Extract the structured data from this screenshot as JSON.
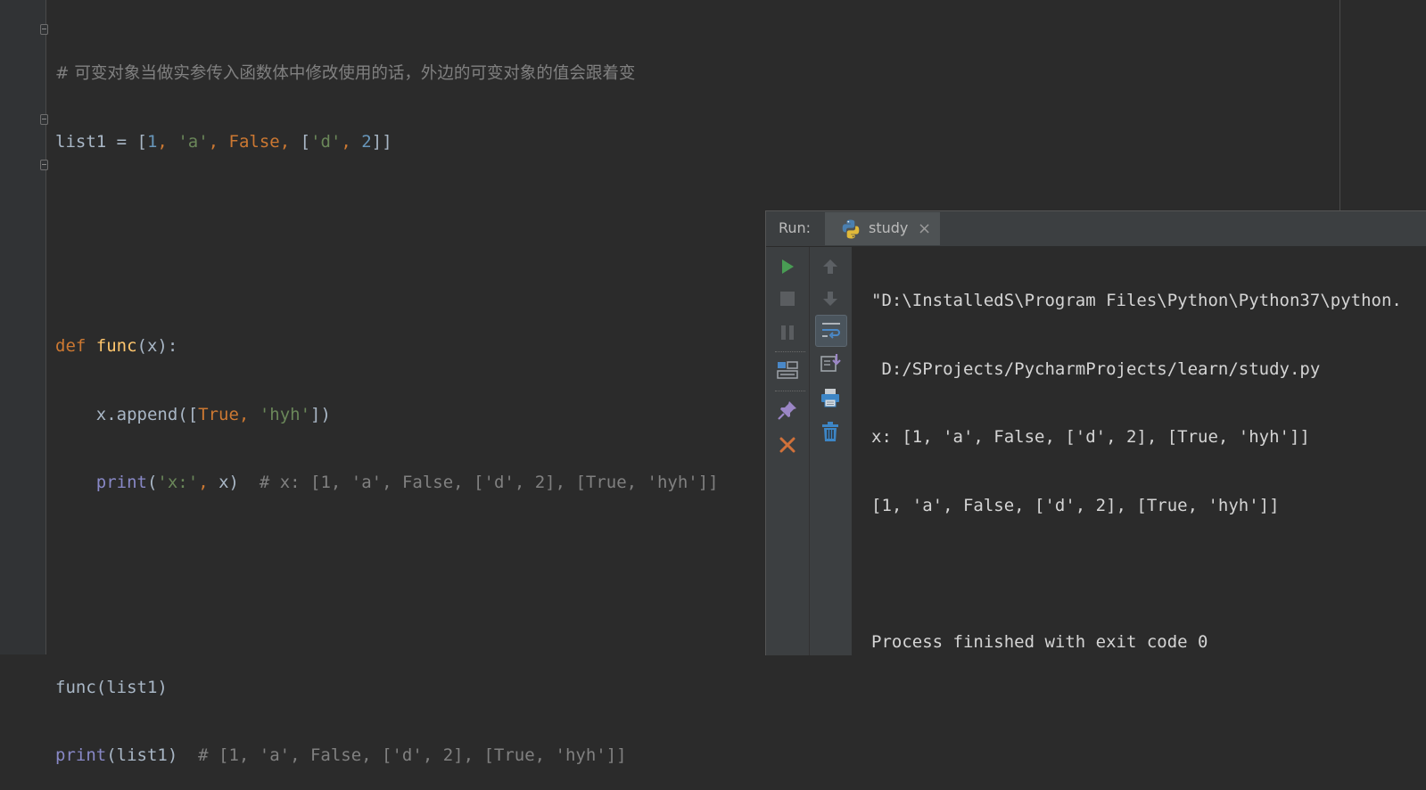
{
  "editor": {
    "line1": {
      "comment": "# 可变对象当做实参传入函数体中修改使用的话，外边的可变对象的值会跟着变"
    },
    "line2": {
      "t1": "list1 = ",
      "t2": "[",
      "t3": "1",
      "t4": ", ",
      "t5": "'a'",
      "t6": ", ",
      "t7": "False",
      "t8": ", ",
      "t9": "[",
      "t10": "'d'",
      "t11": ", ",
      "t12": "2",
      "t13": "]]"
    },
    "line5": {
      "t1": "def ",
      "t2": "func",
      "t3": "(x):"
    },
    "line6": {
      "t1": "    x.append([",
      "t2": "True",
      "t3": ", ",
      "t4": "'hyh'",
      "t5": "])"
    },
    "line7": {
      "t1": "    ",
      "t2": "print",
      "t3": "(",
      "t4": "'x:'",
      "t5": ", ",
      "t6": "x)  ",
      "t7": "# x: [1, 'a', False, ['d', 2], [True, 'hyh']]"
    },
    "line10": {
      "t1": "func(list1)"
    },
    "line11": {
      "t1": "print",
      "t2": "(list1)  ",
      "t3": "# [1, 'a', False, ['d', 2], [True, 'hyh']]"
    }
  },
  "run_panel": {
    "label": "Run:",
    "tab": {
      "label": "study",
      "close": "×",
      "icon": "python-icon"
    },
    "toolbar_left": [
      "run-icon",
      "stop-icon",
      "pause-icon",
      "layout-icon",
      "pin-icon",
      "close-icon"
    ],
    "toolbar_right": [
      "up-arrow-icon",
      "down-arrow-icon",
      "soft-wrap-icon",
      "scroll-to-end-icon",
      "print-icon",
      "trash-icon"
    ],
    "console_lines": [
      "\"D:\\InstalledS\\Program Files\\Python\\Python37\\python.",
      " D:/SProjects/PycharmProjects/learn/study.py",
      "x: [1, 'a', False, ['d', 2], [True, 'hyh']]",
      "[1, 'a', False, ['d', 2], [True, 'hyh']]",
      "",
      "Process finished with exit code 0"
    ]
  },
  "colors": {
    "editor_bg": "#2b2b2b",
    "comment": "#808080",
    "number": "#6897bb",
    "string": "#6a8759",
    "keyword": "#cc7832",
    "function": "#ffc66d",
    "builtin": "#8888c6",
    "run_green": "#499c54",
    "close_orange": "#c75450"
  }
}
